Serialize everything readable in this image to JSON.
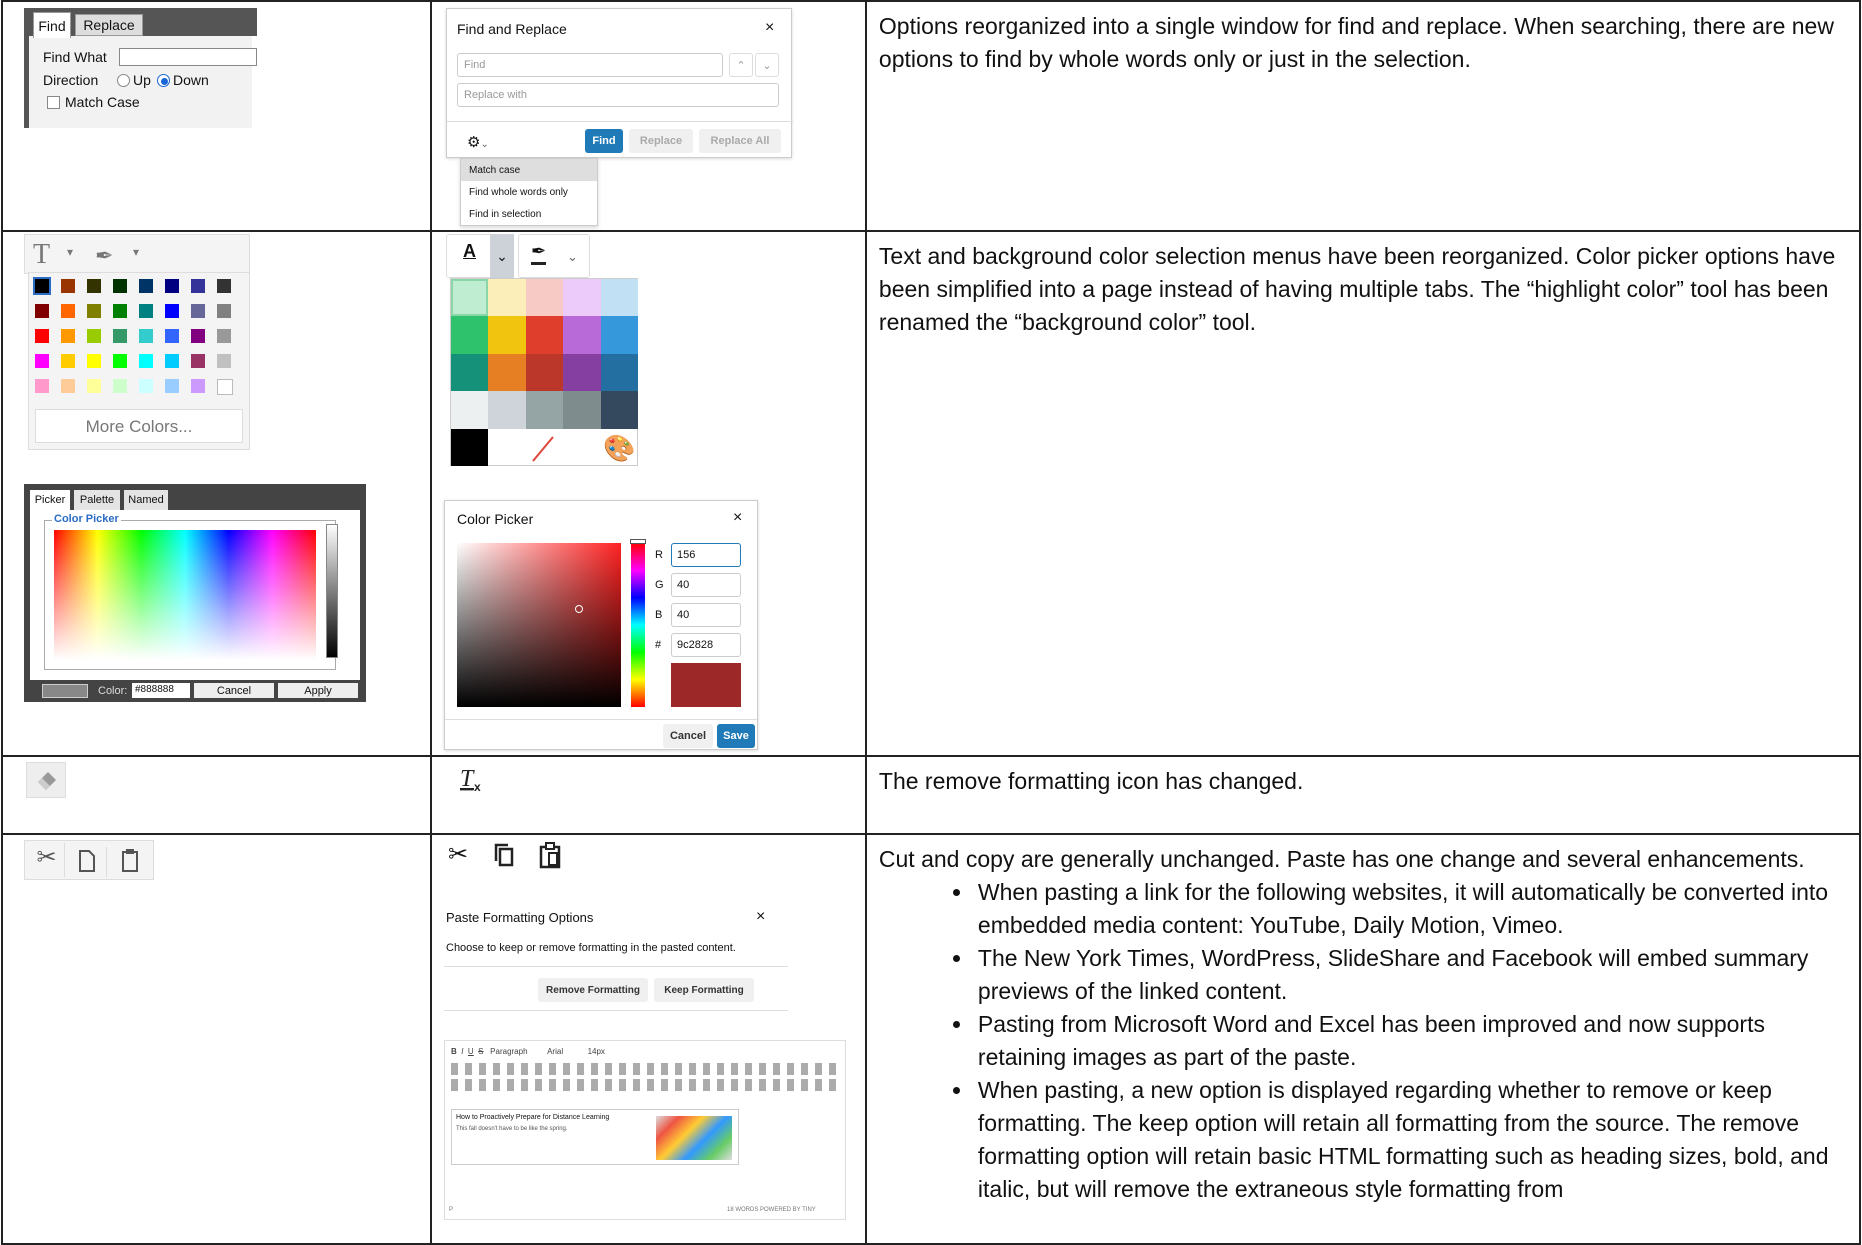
{
  "row1": {
    "old": {
      "tab_find": "Find",
      "tab_replace": "Replace",
      "find_what_label": "Find What",
      "direction_label": "Direction",
      "up_label": "Up",
      "down_label": "Down",
      "match_case_label": "Match Case"
    },
    "new": {
      "title": "Find and Replace",
      "close": "×",
      "find_placeholder": "Find",
      "replace_placeholder": "Replace with",
      "find_btn": "Find",
      "replace_btn": "Replace",
      "replace_all_btn": "Replace All",
      "menu": [
        "Match case",
        "Find whole words only",
        "Find in selection"
      ]
    },
    "description": "Options reorganized into a single window for find and replace. When searching, there are new options to find by whole words only or just in the selection."
  },
  "row2": {
    "old": {
      "more_colors": "More Colors...",
      "tab_picker": "Picker",
      "tab_palette": "Palette",
      "tab_named": "Named",
      "group_label": "Color Picker",
      "color_label": "Color:",
      "color_value": "#888888",
      "cancel": "Cancel",
      "apply": "Apply"
    },
    "new": {
      "title": "Color Picker",
      "close": "×",
      "r_label": "R",
      "r_value": "156",
      "g_label": "G",
      "g_value": "40",
      "b_label": "B",
      "b_value": "40",
      "hex_label": "#",
      "hex_value": "9c2828",
      "cancel": "Cancel",
      "save": "Save",
      "preview_color": "#9c2828"
    },
    "description": "Text and background color selection menus have been reorganized. Color picker options have been simplified into a page instead of having multiple tabs. The “highlight color” tool has been renamed the “background color” tool."
  },
  "row3": {
    "description": "The remove formatting icon has changed."
  },
  "row4": {
    "new": {
      "dialog_title": "Paste Formatting Options",
      "close": "×",
      "dialog_text": "Choose to keep or remove formatting in the pasted content.",
      "remove_btn": "Remove Formatting",
      "keep_btn": "Keep Formatting",
      "editor_heading": "How to Proactively Prepare for Distance Learning",
      "editor_sub": "This fall doesn't have to be like the spring.",
      "status_left": "P",
      "status_right": "18 WORDS  POWERED BY TINY",
      "block_format": "Paragraph",
      "font": "Arial",
      "size": "14px"
    },
    "description_intro": "Cut and copy are generally unchanged. Paste has one change and several enhancements.",
    "bullets": [
      "When pasting a link for the following websites, it will automatically be converted into embedded media content: YouTube, Daily Motion, Vimeo.",
      "The New York Times, WordPress, SlideShare and Facebook will embed summary previews of the linked content.",
      "Pasting from Microsoft Word and Excel has been improved and now supports retaining images as part of the paste.",
      "When pasting, a new option is displayed regarding whether to remove or keep formatting. The keep option will retain all formatting from the source. The remove formatting option will retain basic HTML formatting such as heading sizes, bold, and italic, but will remove the extraneous style formatting from"
    ]
  }
}
